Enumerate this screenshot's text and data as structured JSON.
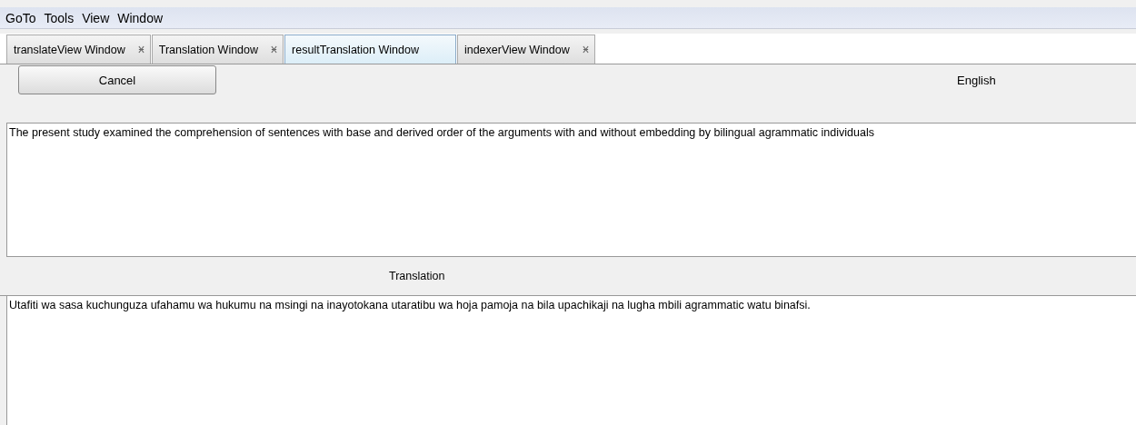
{
  "menu": [
    "GoTo",
    "Tools",
    "View",
    "Window"
  ],
  "tabs": [
    {
      "label": "translateView Window",
      "selected": false,
      "closable": true
    },
    {
      "label": "Translation Window",
      "selected": false,
      "closable": true
    },
    {
      "label": "resultTranslation Window",
      "selected": true,
      "closable": false
    },
    {
      "label": "indexerView Window",
      "selected": false,
      "closable": true
    }
  ],
  "toolbar": {
    "button": "Cancel",
    "language": "English"
  },
  "source_text": "The present study examined the comprehension of sentences with base and derived order of the arguments with and without embedding by bilingual agrammatic individuals",
  "translation_label": "Translation",
  "translation_text": "Utafiti wa sasa kuchunguza ufahamu wa hukumu na msingi na inayotokana utaratibu wa hoja pamoja na bila upachikaji na lugha mbili agrammatic watu binafsi."
}
